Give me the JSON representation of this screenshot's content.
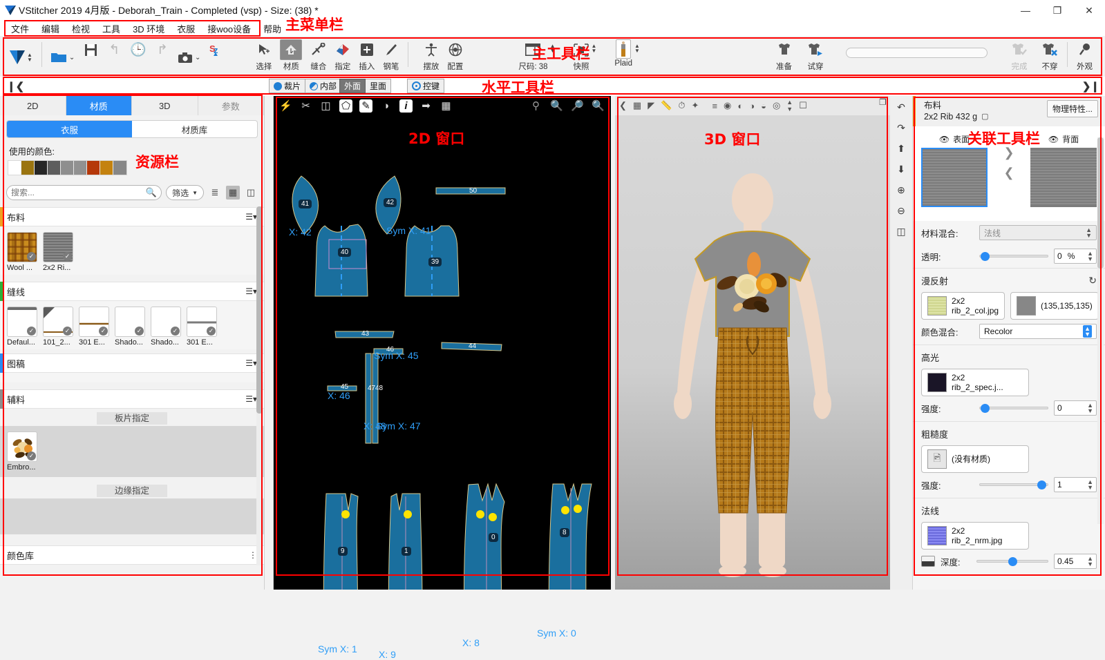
{
  "window": {
    "title": "VStitcher 2019 4月版 - Deborah_Train - Completed (vsp) - Size: (38) *",
    "minimize": "—",
    "maximize": "❐",
    "close": "✕"
  },
  "annotations": {
    "menu": "主菜单栏",
    "main_toolbar": "主工具栏",
    "horizontal_toolbar": "水平工具栏",
    "resource_panel": "资源栏",
    "window_2d": "2D 窗口",
    "window_3d": "3D 窗口",
    "context_toolbar": "关联工具栏"
  },
  "menubar": {
    "items": [
      "文件",
      "编辑",
      "检视",
      "工具",
      "3D 环境",
      "衣服",
      "接woo设备",
      "帮助"
    ]
  },
  "toolbar": {
    "groups": [
      {
        "tools": [
          {
            "name": "logo",
            "icon": "vstitcher-logo-icon",
            "label": "",
            "spinner": true
          },
          {
            "name": "open",
            "icon": "folder-icon",
            "label": "",
            "dropdown": true
          },
          {
            "name": "save",
            "icon": "save-icon",
            "label": ""
          },
          {
            "name": "undo",
            "icon": "undo-icon",
            "label": "",
            "disabled": true
          },
          {
            "name": "history",
            "icon": "clock-icon",
            "label": "",
            "disabled": true
          },
          {
            "name": "redo",
            "icon": "redo-icon",
            "label": "",
            "disabled": true
          },
          {
            "name": "snapshot",
            "icon": "camera-icon",
            "label": "",
            "dropdown": true
          },
          {
            "name": "sync",
            "icon": "sync-icon",
            "label": ""
          }
        ]
      },
      {
        "tools": [
          {
            "name": "select",
            "icon": "cursor-move-icon",
            "label": "选择"
          },
          {
            "name": "material",
            "icon": "arrow-up-box-icon",
            "label": "材质",
            "boxed": true
          },
          {
            "name": "stitch",
            "icon": "needle-icon",
            "label": "缝合"
          },
          {
            "name": "assign",
            "icon": "assign-icon",
            "label": "指定"
          },
          {
            "name": "insert",
            "icon": "plus-box-icon",
            "label": "插入"
          },
          {
            "name": "pen",
            "icon": "pen-icon",
            "label": "钢笔"
          }
        ]
      },
      {
        "tools": [
          {
            "name": "arrange",
            "icon": "avatar-pose-icon",
            "label": "摆放"
          },
          {
            "name": "configure",
            "icon": "sphere-grid-icon",
            "label": "配置"
          }
        ]
      },
      {
        "tools": [
          {
            "name": "size",
            "icon": "size-window-icon",
            "label": "尺码: 38",
            "spinner": true
          },
          {
            "name": "snapshot-preset",
            "icon": "garment-frame-icon",
            "label": "快照",
            "spinner": true
          },
          {
            "name": "colorway",
            "icon": "avatar-plaid-icon",
            "label": "Plaid",
            "spinner": true,
            "boxedLight": true
          }
        ]
      },
      {
        "tools": [
          {
            "name": "prepare",
            "icon": "shirt-icon",
            "label": "准备"
          },
          {
            "name": "try-on",
            "icon": "shirt-play-icon",
            "label": "试穿"
          }
        ]
      },
      {
        "tools": [
          {
            "name": "finish",
            "icon": "shirt-check-icon",
            "label": "完成",
            "disabled": true
          },
          {
            "name": "undress",
            "icon": "shirt-x-icon",
            "label": "不穿"
          },
          {
            "name": "appearance",
            "icon": "magnifier-icon",
            "label": "外观"
          }
        ]
      }
    ]
  },
  "horizontal_bar": {
    "collapse_left": "❙❮",
    "collapse_right": "❯❙",
    "group1": [
      {
        "label": "裁片",
        "icon": "piece-icon",
        "active": false
      },
      {
        "label": "内部",
        "icon": "internal-icon",
        "active": false
      }
    ],
    "group2": [
      {
        "label": "外面",
        "active": true
      },
      {
        "label": "里面",
        "active": false
      }
    ],
    "group3": [
      {
        "label": "控键",
        "icon": "control-icon"
      }
    ]
  },
  "left_panel": {
    "tabs": [
      {
        "label": "2D",
        "active": false
      },
      {
        "label": "材质",
        "active": true
      },
      {
        "label": "3D",
        "active": false
      },
      {
        "label": "参数",
        "active": false,
        "dim": true
      }
    ],
    "subtabs": [
      {
        "label": "衣服",
        "active": true
      },
      {
        "label": "材质库",
        "active": false
      }
    ],
    "used_colors_label": "使用的颜色:",
    "used_colors": [
      "#ffffff",
      "#9a7410",
      "#262626",
      "#5e5e5e",
      "#8e8e8e",
      "#919191",
      "#b5380a",
      "#c4820f",
      "#878787"
    ],
    "search_placeholder": "搜索...",
    "filter_label": "筛选",
    "sections": [
      {
        "title": "布料",
        "accent": "#f0a020",
        "items": [
          {
            "name": "Wool ...",
            "swatch": "plaid"
          },
          {
            "name": "2x2 Ri...",
            "swatch": "grey-rib"
          }
        ]
      },
      {
        "title": "缝线",
        "accent": "#2fb03a",
        "items": [
          {
            "name": "Defaul...",
            "swatch": "seam-default"
          },
          {
            "name": "101_2...",
            "swatch": "seam-101"
          },
          {
            "name": "301 E...",
            "swatch": "seam-301a"
          },
          {
            "name": "Shado...",
            "swatch": "seam-shadow-a"
          },
          {
            "name": "Shado...",
            "swatch": "seam-shadow-b"
          },
          {
            "name": "301 E...",
            "swatch": "seam-301b"
          }
        ]
      },
      {
        "title": "图稿",
        "accent": "#2a8cf5",
        "items": []
      },
      {
        "title": "辅料",
        "accent": "#8e8e8e",
        "items": []
      }
    ],
    "sub_sections": [
      {
        "title": "板片指定",
        "items": [
          {
            "name": "Embro...",
            "swatch": "embroidery"
          }
        ]
      },
      {
        "title": "边缘指定",
        "items": []
      }
    ],
    "footer_section": "颜色库"
  },
  "window_2d": {
    "toolbar_left_icons": [
      "lightning-icon",
      "needle-icon",
      "layers-icon",
      "polygon-icon",
      "pencil-shape-icon",
      "half-circle-icon",
      "info-icon",
      "arrow-right-hex-icon",
      "grid-icon"
    ],
    "toolbar_right_icons": [
      "zoom-fit-icon",
      "zoom-region-icon",
      "zoom-in-icon",
      "zoom-out-icon"
    ],
    "pieces": [
      {
        "num": "41",
        "label": "X: 42"
      },
      {
        "num": "42",
        "label": "Sym X: 41"
      },
      {
        "num": "50",
        "label": ""
      },
      {
        "num": "40",
        "label": ""
      },
      {
        "num": "39",
        "label": ""
      },
      {
        "num": "43",
        "label": ""
      },
      {
        "num": "44",
        "label": ""
      },
      {
        "num": "46",
        "label": "Sym X: 45"
      },
      {
        "num": "45",
        "label": "X: 46"
      },
      {
        "num": "47",
        "label": ""
      },
      {
        "num": "48",
        "label": ""
      },
      {
        "num": "9",
        "label": "Sym X: 1"
      },
      {
        "num": "1",
        "label": "X: 9"
      },
      {
        "num": "0",
        "label": "X: 8"
      },
      {
        "num": "8",
        "label": "Sym X: 0"
      },
      {
        "num": "",
        "label": "X: 48"
      },
      {
        "num": "",
        "label": "Sym X: 47"
      }
    ]
  },
  "window_3d": {
    "toolbar_icons": [
      "back-icon",
      "grid-icon",
      "plane-icon",
      "ruler-icon",
      "tension-icon",
      "stress-icon",
      "align-icon",
      "view-front-icon",
      "view-left-icon",
      "view-back-icon",
      "view-right-icon",
      "view-persp-icon",
      "chevron-down-icon",
      "window-icon"
    ]
  },
  "vertical_rail": {
    "icons": [
      "undo-arrow-icon",
      "redo-arrow-icon",
      "move-up-icon",
      "move-down-icon",
      "zoom-in-icon",
      "zoom-out-icon",
      "fit-icon"
    ]
  },
  "right_panel": {
    "header": {
      "kind": "布料",
      "name": "2x2 Rib 432 g",
      "badge_icon": "fabric-info-icon",
      "button": "物理特性..."
    },
    "preview": {
      "front_label": "表面",
      "back_label": "背面",
      "eye_icon": "eye-icon",
      "next_icon": "chevron-right-icon",
      "prev_icon": "chevron-left-icon"
    },
    "material_blend": {
      "label": "材料混合:",
      "value": "法线"
    },
    "transparency": {
      "label": "透明:",
      "value": "0",
      "unit": "%",
      "percent": 5
    },
    "diffuse": {
      "title": "漫反射",
      "reset_icon": "reset-icon",
      "texture": "2x2\nrib_2_col.jpg",
      "texture_line1": "2x2",
      "texture_line2": "rib_2_col.jpg",
      "color_value": "(135,135,135)",
      "color_hex": "#878787",
      "blend_label": "颜色混合:",
      "blend_value": "Recolor"
    },
    "specular": {
      "title": "高光",
      "texture_line1": "2x2",
      "texture_line2": "rib_2_spec.j...",
      "swatch_hex": "#1a1527",
      "strength_label": "强度:",
      "strength_value": "0",
      "strength_percent": 8
    },
    "roughness": {
      "title": "粗糙度",
      "texture_label": "(没有材质)",
      "texture_icon": "image-placeholder-icon",
      "strength_label": "强度:",
      "strength_value": "1",
      "strength_percent": 88
    },
    "normal": {
      "title": "法线",
      "texture_line1": "2x2",
      "texture_line2": "rib_2_nrm.jpg",
      "swatch_hex": "#7b7bf0",
      "depth_label": "深度:",
      "depth_value": "0.45",
      "depth_percent": 48,
      "depth_icon": "depth-icon"
    }
  }
}
